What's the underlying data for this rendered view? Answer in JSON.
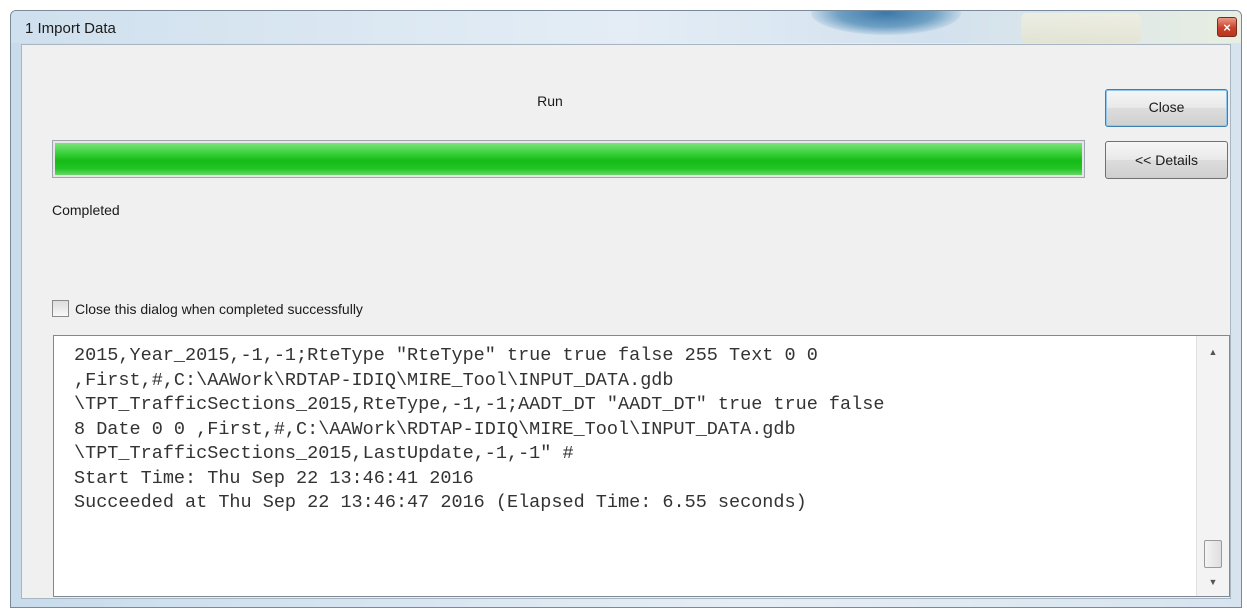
{
  "window": {
    "title": "1 Import Data",
    "close_glyph": "×"
  },
  "header": {
    "run_label": "Run"
  },
  "progress": {
    "percent": 100,
    "fill_color": "#22c424"
  },
  "buttons": {
    "close_label": "Close",
    "details_label": "<< Details"
  },
  "status": {
    "text": "Completed"
  },
  "options": {
    "close_when_done_label": "Close this dialog when completed successfully",
    "close_when_done_checked": false
  },
  "details": {
    "lines": [
      "2015,Year_2015,-1,-1;RteType \"RteType\" true true false 255 Text 0 0",
      ",First,#,C:\\AAWork\\RDTAP-IDIQ\\MIRE_Tool\\INPUT_DATA.gdb",
      "\\TPT_TrafficSections_2015,RteType,-1,-1;AADT_DT \"AADT_DT\" true true false",
      "8 Date 0 0 ,First,#,C:\\AAWork\\RDTAP-IDIQ\\MIRE_Tool\\INPUT_DATA.gdb",
      "\\TPT_TrafficSections_2015,LastUpdate,-1,-1\" #",
      "Start Time: Thu Sep 22 13:46:41 2016",
      "Succeeded at Thu Sep 22 13:46:47 2016 (Elapsed Time: 6.55 seconds)"
    ],
    "scroll_up_icon": "▲",
    "scroll_down_icon": "▼"
  }
}
